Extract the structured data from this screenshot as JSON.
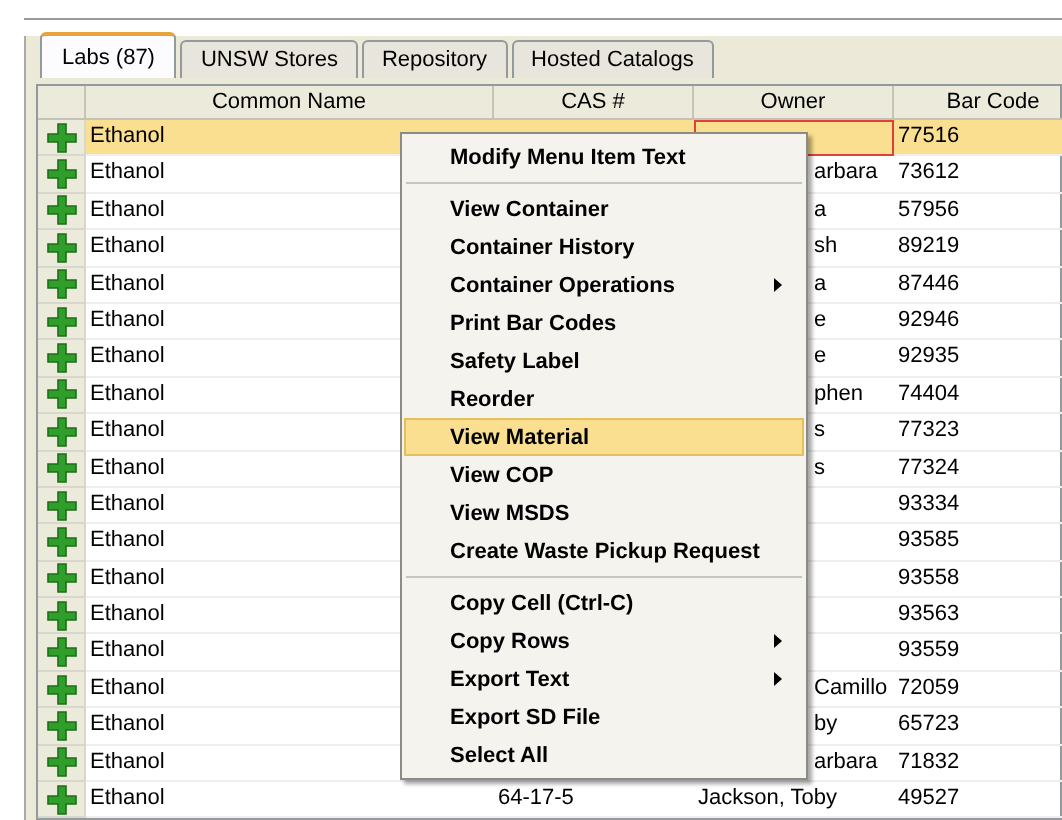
{
  "tabs": [
    {
      "label": "Labs (87)",
      "selected": true
    },
    {
      "label": "UNSW Stores",
      "selected": false
    },
    {
      "label": "Repository",
      "selected": false
    },
    {
      "label": "Hosted Catalogs",
      "selected": false
    }
  ],
  "table": {
    "columns": [
      "Common Name",
      "CAS #",
      "Owner",
      "Bar Code"
    ],
    "rows": [
      {
        "name": "Ethanol",
        "bar_code": "77516",
        "selected": true
      },
      {
        "name": "Ethanol",
        "owner": "arbara",
        "bar_code": "73612",
        "selected": false,
        "covered": true
      },
      {
        "name": "Ethanol",
        "owner": "a",
        "bar_code": "57956",
        "selected": false,
        "covered": true
      },
      {
        "name": "Ethanol",
        "owner": "sh",
        "bar_code": "89219",
        "selected": false,
        "covered": true
      },
      {
        "name": "Ethanol",
        "owner": "a",
        "bar_code": "87446",
        "selected": false,
        "covered": true
      },
      {
        "name": "Ethanol",
        "owner": "e",
        "bar_code": "92946",
        "selected": false,
        "covered": true
      },
      {
        "name": "Ethanol",
        "owner": "e",
        "bar_code": "92935",
        "selected": false,
        "covered": true
      },
      {
        "name": "Ethanol",
        "owner": "phen",
        "bar_code": "74404",
        "selected": false,
        "covered": true
      },
      {
        "name": "Ethanol",
        "owner": "s",
        "bar_code": "77323",
        "selected": false,
        "covered": true
      },
      {
        "name": "Ethanol",
        "owner": "s",
        "bar_code": "77324",
        "selected": false,
        "covered": true
      },
      {
        "name": "Ethanol",
        "bar_code": "93334",
        "selected": false
      },
      {
        "name": "Ethanol",
        "bar_code": "93585",
        "selected": false
      },
      {
        "name": "Ethanol",
        "bar_code": "93558",
        "selected": false
      },
      {
        "name": "Ethanol",
        "bar_code": "93563",
        "selected": false
      },
      {
        "name": "Ethanol",
        "bar_code": "93559",
        "selected": false
      },
      {
        "name": "Ethanol",
        "owner": "Camillo",
        "bar_code": "72059",
        "selected": false,
        "covered": true
      },
      {
        "name": "Ethanol",
        "owner": "by",
        "bar_code": "65723",
        "selected": false,
        "covered": true
      },
      {
        "name": "Ethanol",
        "owner": "arbara",
        "bar_code": "71832",
        "selected": false,
        "covered": true
      },
      {
        "name": "Ethanol",
        "cas": "64-17-5",
        "owner": "Jackson, Toby",
        "bar_code": "49527",
        "selected": false,
        "covered": false
      }
    ]
  },
  "context_menu": {
    "items": [
      {
        "kind": "item",
        "label": "Modify Menu Item Text",
        "submenu": false,
        "selected": false
      },
      {
        "kind": "separator"
      },
      {
        "kind": "item",
        "label": "View Container",
        "submenu": false,
        "selected": false
      },
      {
        "kind": "item",
        "label": "Container History",
        "submenu": false,
        "selected": false
      },
      {
        "kind": "item",
        "label": "Container Operations",
        "submenu": true,
        "selected": false
      },
      {
        "kind": "item",
        "label": "Print Bar Codes",
        "submenu": false,
        "selected": false
      },
      {
        "kind": "item",
        "label": "Safety Label",
        "submenu": false,
        "selected": false
      },
      {
        "kind": "item",
        "label": "Reorder",
        "submenu": false,
        "selected": false
      },
      {
        "kind": "item",
        "label": "View Material",
        "submenu": false,
        "selected": true
      },
      {
        "kind": "item",
        "label": "View COP",
        "submenu": false,
        "selected": false
      },
      {
        "kind": "item",
        "label": "View MSDS",
        "submenu": false,
        "selected": false
      },
      {
        "kind": "item",
        "label": "Create Waste Pickup Request",
        "submenu": false,
        "selected": false
      },
      {
        "kind": "separator"
      },
      {
        "kind": "item",
        "label": "Copy Cell  (Ctrl-C)",
        "submenu": false,
        "selected": false
      },
      {
        "kind": "item",
        "label": "Copy Rows",
        "submenu": true,
        "selected": false
      },
      {
        "kind": "item",
        "label": "Export Text",
        "submenu": true,
        "selected": false
      },
      {
        "kind": "item",
        "label": "Export SD File",
        "submenu": false,
        "selected": false
      },
      {
        "kind": "item",
        "label": "Select All",
        "submenu": false,
        "selected": false
      }
    ]
  }
}
